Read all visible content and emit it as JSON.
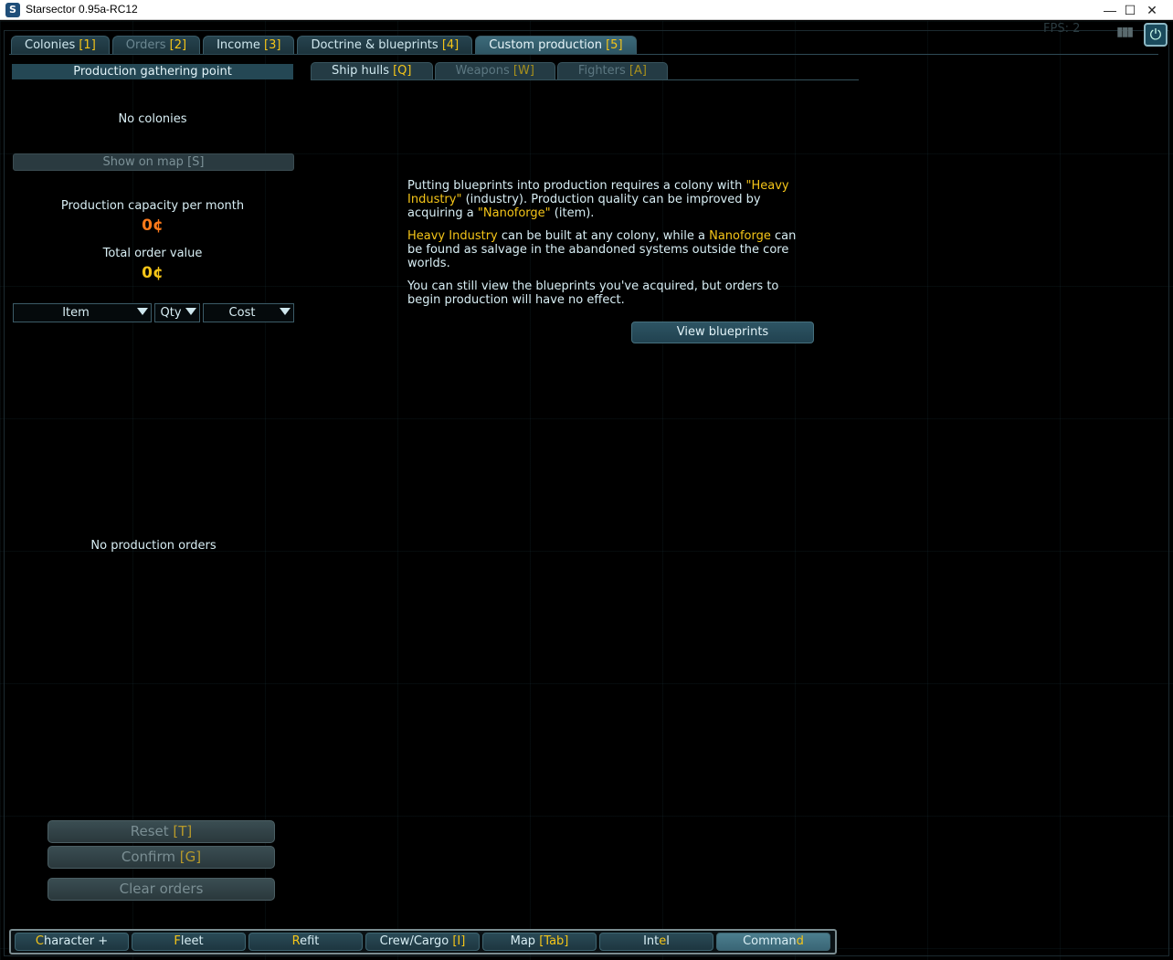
{
  "window": {
    "title": "Starsector 0.95a-RC12",
    "controls": {
      "minimize": "—",
      "maximize": "☐",
      "close": "✕"
    }
  },
  "main_tabs": [
    {
      "label": "Colonies ",
      "hotkey": "[1]"
    },
    {
      "label": "Orders ",
      "hotkey": "[2]"
    },
    {
      "label": "Income ",
      "hotkey": "[3]"
    },
    {
      "label": "Doctrine & blueprints ",
      "hotkey": "[4]"
    },
    {
      "label": "Custom production ",
      "hotkey": "[5]"
    }
  ],
  "left_panel": {
    "header": "Production gathering point",
    "no_colonies": "No colonies",
    "show_on_map": "Show on map [S]",
    "capacity_label": "Production capacity per month",
    "capacity_value": "0¢",
    "total_label": "Total order value",
    "total_value": "0¢",
    "columns": {
      "item": "Item",
      "qty": "Qty",
      "cost": "Cost"
    },
    "no_orders": "No production orders",
    "reset": {
      "label": "Reset ",
      "hotkey": "[T]"
    },
    "confirm": {
      "label": "Confirm ",
      "hotkey": "[G]"
    },
    "clear": "Clear orders"
  },
  "sub_tabs": [
    {
      "label": "Ship hulls ",
      "hotkey": "[Q]"
    },
    {
      "label": "Weapons ",
      "hotkey": "[W]"
    },
    {
      "label": "Fighters ",
      "hotkey": "[A]"
    }
  ],
  "info": {
    "p1_a": "Putting blueprints into production requires a colony with ",
    "p1_hl1": "\"Heavy Industry\"",
    "p1_b": " (industry). Production quality can be improved by acquiring a ",
    "p1_hl2": "\"Nanoforge\"",
    "p1_c": " (item).",
    "p2_hl1": "Heavy Industry",
    "p2_a": " can be built at any colony, while a ",
    "p2_hl2": "Nanoforge",
    "p2_b": " can be found as salvage in the abandoned systems outside the core worlds.",
    "p3": "You can still view the blueprints you've acquired, but orders to begin production will have no effect.",
    "view_blueprints": "View blueprints"
  },
  "bottom_tabs": [
    {
      "hotkey": "C",
      "rest": "haracter +"
    },
    {
      "hotkey": "F",
      "rest": "leet"
    },
    {
      "hotkey": "R",
      "rest": "efit"
    },
    {
      "pre": "Crew/Cargo ",
      "hotkey": "[I]",
      "rest": ""
    },
    {
      "pre": "Map ",
      "hotkey": "[Tab]",
      "rest": ""
    },
    {
      "pre": "Int",
      "hotkey": "e",
      "rest": "l"
    },
    {
      "pre": "Comman",
      "hotkey": "d",
      "rest": ""
    }
  ],
  "fps_text": "FPS: 2",
  "colors": {
    "accent_yellow": "#f5c518",
    "orange_value": "#ff7a1a",
    "panel_teal": "#244754"
  }
}
